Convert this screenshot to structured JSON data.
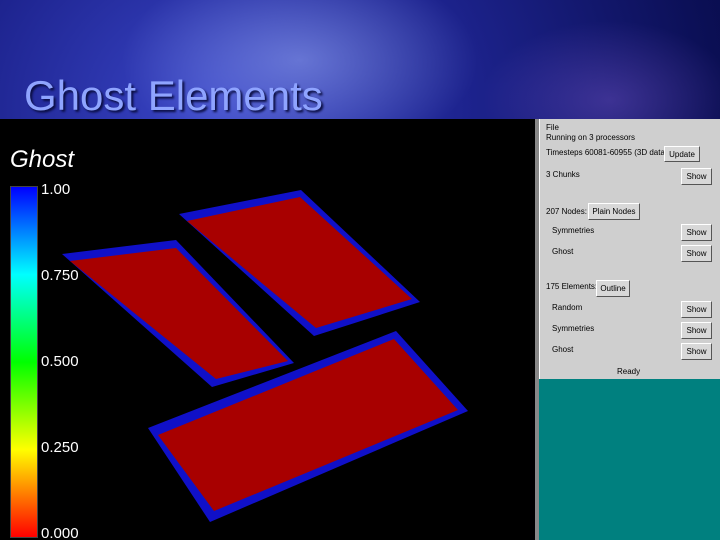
{
  "slide": {
    "title": "Ghost Elements"
  },
  "viewport": {
    "label": "Ghost",
    "colorbar_ticks": [
      "1.00",
      "0.750",
      "0.500",
      "0.250",
      "0.000"
    ]
  },
  "panel": {
    "file_label": "File",
    "running_text": "Running on 3 processors",
    "timesteps_text": "Timesteps 60081-60955 (3D data)",
    "update_label": "Update",
    "chunks_label": "3 Chunks",
    "chunks_show": "Show",
    "nodes_label": "207 Nodes:",
    "plain_nodes_label": "Plain Nodes",
    "symmetries_label": "Symmetries",
    "nodes_symmetries_show": "Show",
    "ghosts_label": "Ghost",
    "nodes_ghosts_show": "Show",
    "elements_label": "175 Elements:",
    "outline_label": "Outline",
    "random_label": "Random",
    "random_show": "Show",
    "el_symmetries_label": "Symmetries",
    "el_symmetries_show": "Show",
    "el_ghosts_label": "Ghost",
    "el_ghosts_show": "Show",
    "status": "Ready"
  },
  "colors": {
    "element_fill": "#a80000",
    "ghost_edge": "#1010c8",
    "panel_bg": "#cfcfcf",
    "teal": "#00807f"
  }
}
